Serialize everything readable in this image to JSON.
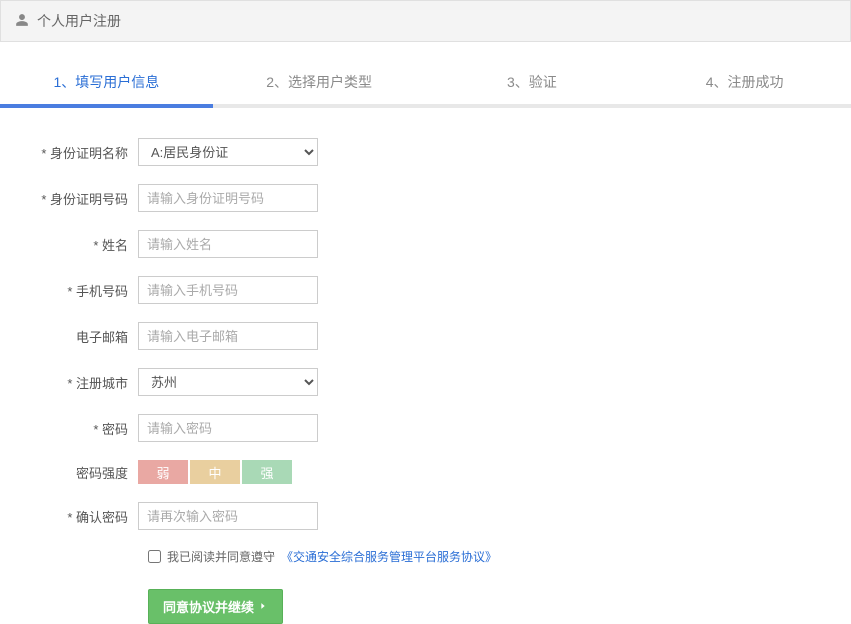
{
  "header": {
    "title": "个人用户注册"
  },
  "steps": [
    {
      "label": "1、填写用户信息",
      "active": true
    },
    {
      "label": "2、选择用户类型",
      "active": false
    },
    {
      "label": "3、验证",
      "active": false
    },
    {
      "label": "4、注册成功",
      "active": false
    }
  ],
  "form": {
    "id_type": {
      "label": "* 身份证明名称",
      "selected": "A:居民身份证",
      "options": [
        "A:居民身份证"
      ]
    },
    "id_number": {
      "label": "* 身份证明号码",
      "placeholder": "请输入身份证明号码",
      "value": ""
    },
    "name": {
      "label": "* 姓名",
      "placeholder": "请输入姓名",
      "value": ""
    },
    "mobile": {
      "label": "* 手机号码",
      "placeholder": "请输入手机号码",
      "value": ""
    },
    "email": {
      "label": "电子邮箱",
      "placeholder": "请输入电子邮箱",
      "value": ""
    },
    "city": {
      "label": "* 注册城市",
      "selected": "苏州",
      "options": [
        "苏州"
      ]
    },
    "password": {
      "label": "* 密码",
      "placeholder": "请输入密码",
      "value": ""
    },
    "strength": {
      "label": "密码强度",
      "weak": "弱",
      "mid": "中",
      "strong": "强"
    },
    "confirm": {
      "label": "* 确认密码",
      "placeholder": "请再次输入密码",
      "value": ""
    }
  },
  "agree": {
    "checked": false,
    "prefix": "我已阅读并同意遵守",
    "link": "《交通安全综合服务管理平台服务协议》"
  },
  "submit": {
    "label": "同意协议并继续"
  }
}
